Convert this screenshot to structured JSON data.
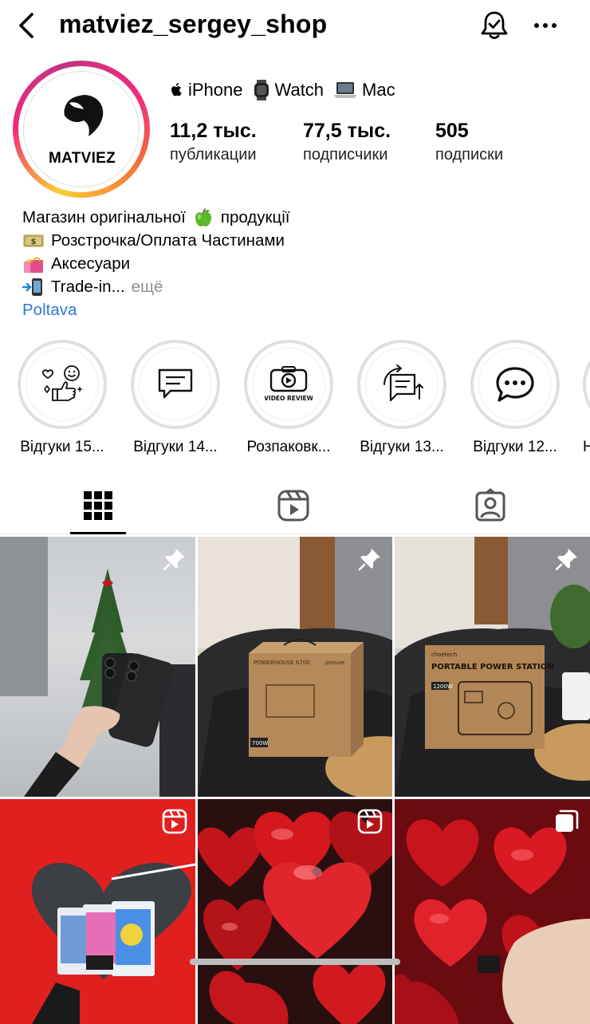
{
  "header": {
    "username": "matviez_sergey_shop",
    "back_icon": "chevron-left-icon",
    "bell_icon": "bell-check-icon",
    "more_icon": "ellipsis-icon"
  },
  "profile": {
    "avatar_text": "MATVIEZ",
    "category_items": [
      {
        "icon": "apple-icon",
        "label": "iPhone"
      },
      {
        "icon": "watch-icon",
        "label": "Watch"
      },
      {
        "icon": "laptop-icon",
        "label": "Mac"
      }
    ],
    "stats": [
      {
        "value": "11,2 тыс.",
        "label": "публикации"
      },
      {
        "value": "77,5 тыс.",
        "label": "подписчики"
      },
      {
        "value": "505",
        "label": "подписки"
      }
    ]
  },
  "bio": {
    "lines": [
      {
        "text_before": "Магазин оригінальної",
        "emoji": "green-apple-icon",
        "text_after": "продукції"
      },
      {
        "emoji": "money-icon",
        "text": "Розстрочка/Оплата Частинами"
      },
      {
        "emoji": "shopping-bags-icon",
        "text": "Аксесуари"
      },
      {
        "emoji": "phone-arrow-icon",
        "text": "Trade-in...",
        "more": "ещё"
      }
    ],
    "location": "Poltava"
  },
  "highlights": [
    {
      "label": "Відгуки 15...",
      "icon": "reviews-hearts-icon"
    },
    {
      "label": "Відгуки 14...",
      "icon": "message-icon"
    },
    {
      "label": "Розпаковк...",
      "icon": "video-review-icon"
    },
    {
      "label": "Відгуки 13...",
      "icon": "messages-exchange-icon"
    },
    {
      "label": "Відгуки 12...",
      "icon": "chat-bubble-icon"
    },
    {
      "label": "Н",
      "icon": "partial-icon"
    }
  ],
  "tabs": [
    {
      "name": "grid",
      "icon": "grid-icon",
      "active": true
    },
    {
      "name": "reels",
      "icon": "reels-icon",
      "active": false
    },
    {
      "name": "tagged",
      "icon": "tagged-icon",
      "active": false
    }
  ],
  "posts": [
    {
      "badge": "pin-icon",
      "subject": "hand-holding-two-black-iphones"
    },
    {
      "badge": "pin-icon",
      "subject": "powerhouse-box-on-sofa",
      "box_text": "POWERHOUSE 6700",
      "brand": "prouve",
      "tag": "700W"
    },
    {
      "badge": "pin-icon",
      "subject": "portable-power-station-box",
      "brand": "choetech",
      "box_title": "PORTABLE POWER STATION",
      "tag": "1200W"
    },
    {
      "badge": "reels-icon",
      "subject": "ipads-heart-display"
    },
    {
      "badge": "reels-icon",
      "subject": "red-heart-balloons"
    },
    {
      "badge": "carousel-icon",
      "subject": "red-hearts-hand"
    }
  ]
}
